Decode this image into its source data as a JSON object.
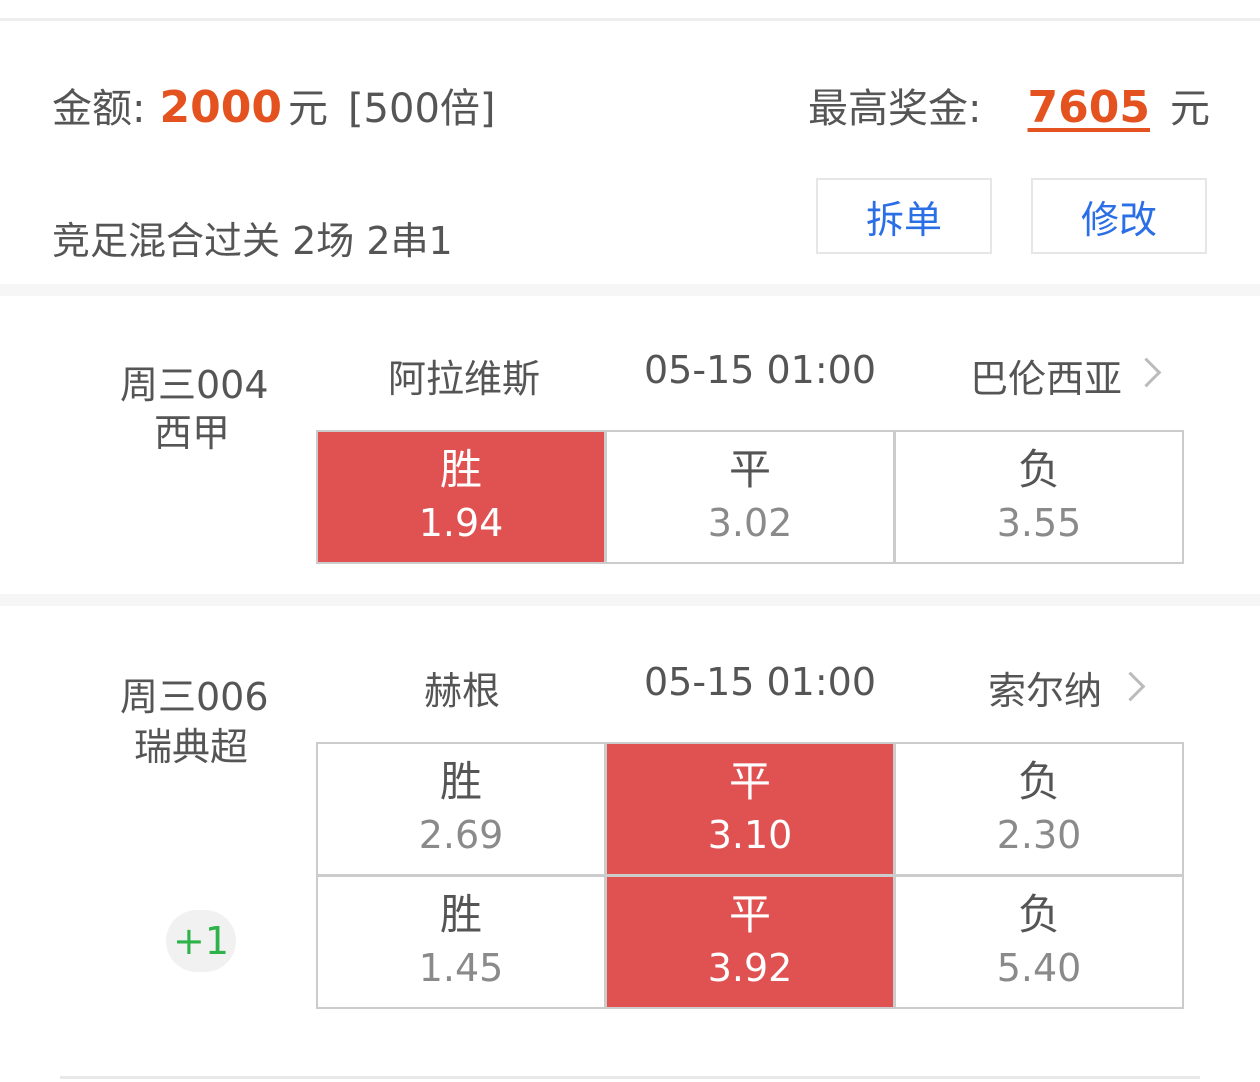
{
  "summary": {
    "amount_label": "金额:",
    "amount_value": "2000",
    "amount_unit": "元",
    "multiplier": "[500倍]",
    "max_prize_label": "最高奖金:",
    "max_prize_value": "7605",
    "max_prize_unit": "元",
    "play_type": "竞足混合过关 2场 2串1",
    "split_button": "拆单",
    "edit_button": "修改"
  },
  "matches": [
    {
      "id": "周三004",
      "league": "西甲",
      "home": "阿拉维斯",
      "time": "05-15 01:00",
      "away": "巴伦西亚",
      "rows": [
        [
          {
            "label": "胜",
            "odds": "1.94",
            "selected": true
          },
          {
            "label": "平",
            "odds": "3.02",
            "selected": false
          },
          {
            "label": "负",
            "odds": "3.55",
            "selected": false
          }
        ]
      ]
    },
    {
      "id": "周三006",
      "league": "瑞典超",
      "home": "赫根",
      "time": "05-15 01:00",
      "away": "索尔纳",
      "handicap_badge": "+1",
      "rows": [
        [
          {
            "label": "胜",
            "odds": "2.69",
            "selected": false
          },
          {
            "label": "平",
            "odds": "3.10",
            "selected": true
          },
          {
            "label": "负",
            "odds": "2.30",
            "selected": false
          }
        ],
        [
          {
            "label": "胜",
            "odds": "1.45",
            "selected": false
          },
          {
            "label": "平",
            "odds": "3.92",
            "selected": true
          },
          {
            "label": "负",
            "odds": "5.40",
            "selected": false
          }
        ]
      ]
    }
  ]
}
